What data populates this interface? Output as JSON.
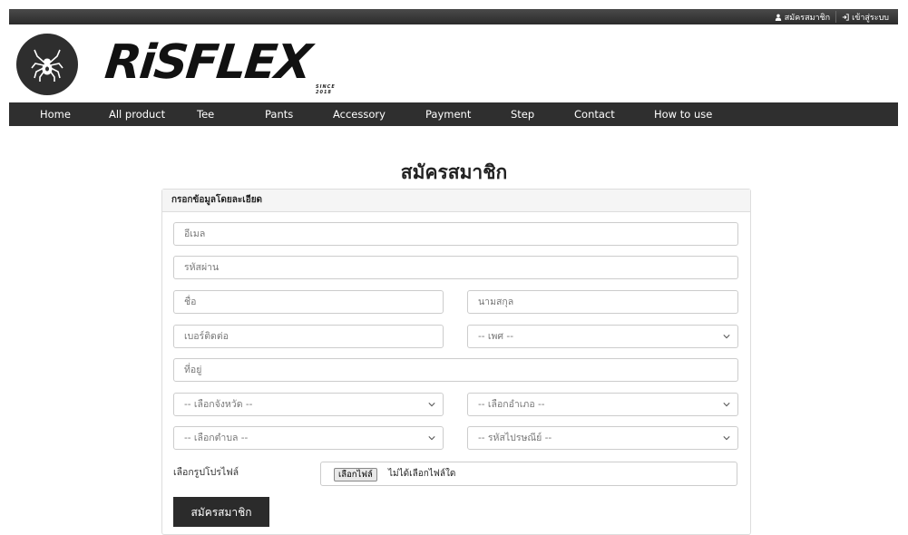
{
  "topbar": {
    "register_label": "สมัครสมาชิก",
    "login_label": "เข้าสู่ระบบ"
  },
  "brand": {
    "logo_text": "RiSFLEX",
    "tagline": "SINCE 2018"
  },
  "nav": {
    "items": [
      "Home",
      "All product",
      "Tee",
      "Pants",
      "Accessory",
      "Payment",
      "Step",
      "Contact",
      "How to use"
    ]
  },
  "page": {
    "title": "สมัครสมาชิก"
  },
  "form": {
    "panel_heading": "กรอกข้อมูลโดยละเอียด",
    "email_placeholder": "อีเมล",
    "password_placeholder": "รหัสผ่าน",
    "firstname_placeholder": "ชื่อ",
    "lastname_placeholder": "นามสกุล",
    "phone_placeholder": "เบอร์ติดต่อ",
    "gender_selected": "-- เพศ --",
    "address_placeholder": "ที่อยู่",
    "province_selected": "-- เลือกจังหวัด --",
    "district_selected": "-- เลือกอำเภอ --",
    "subdistrict_selected": "-- เลือกตำบล --",
    "postcode_selected": "-- รหัสไปรษณีย์ --",
    "profile_label": "เลือกรูปโปรไฟล์",
    "file_button": "เลือกไฟล์",
    "file_status": "ไม่ได้เลือกไฟล์ใด",
    "submit_label": "สมัครสมาชิก"
  }
}
